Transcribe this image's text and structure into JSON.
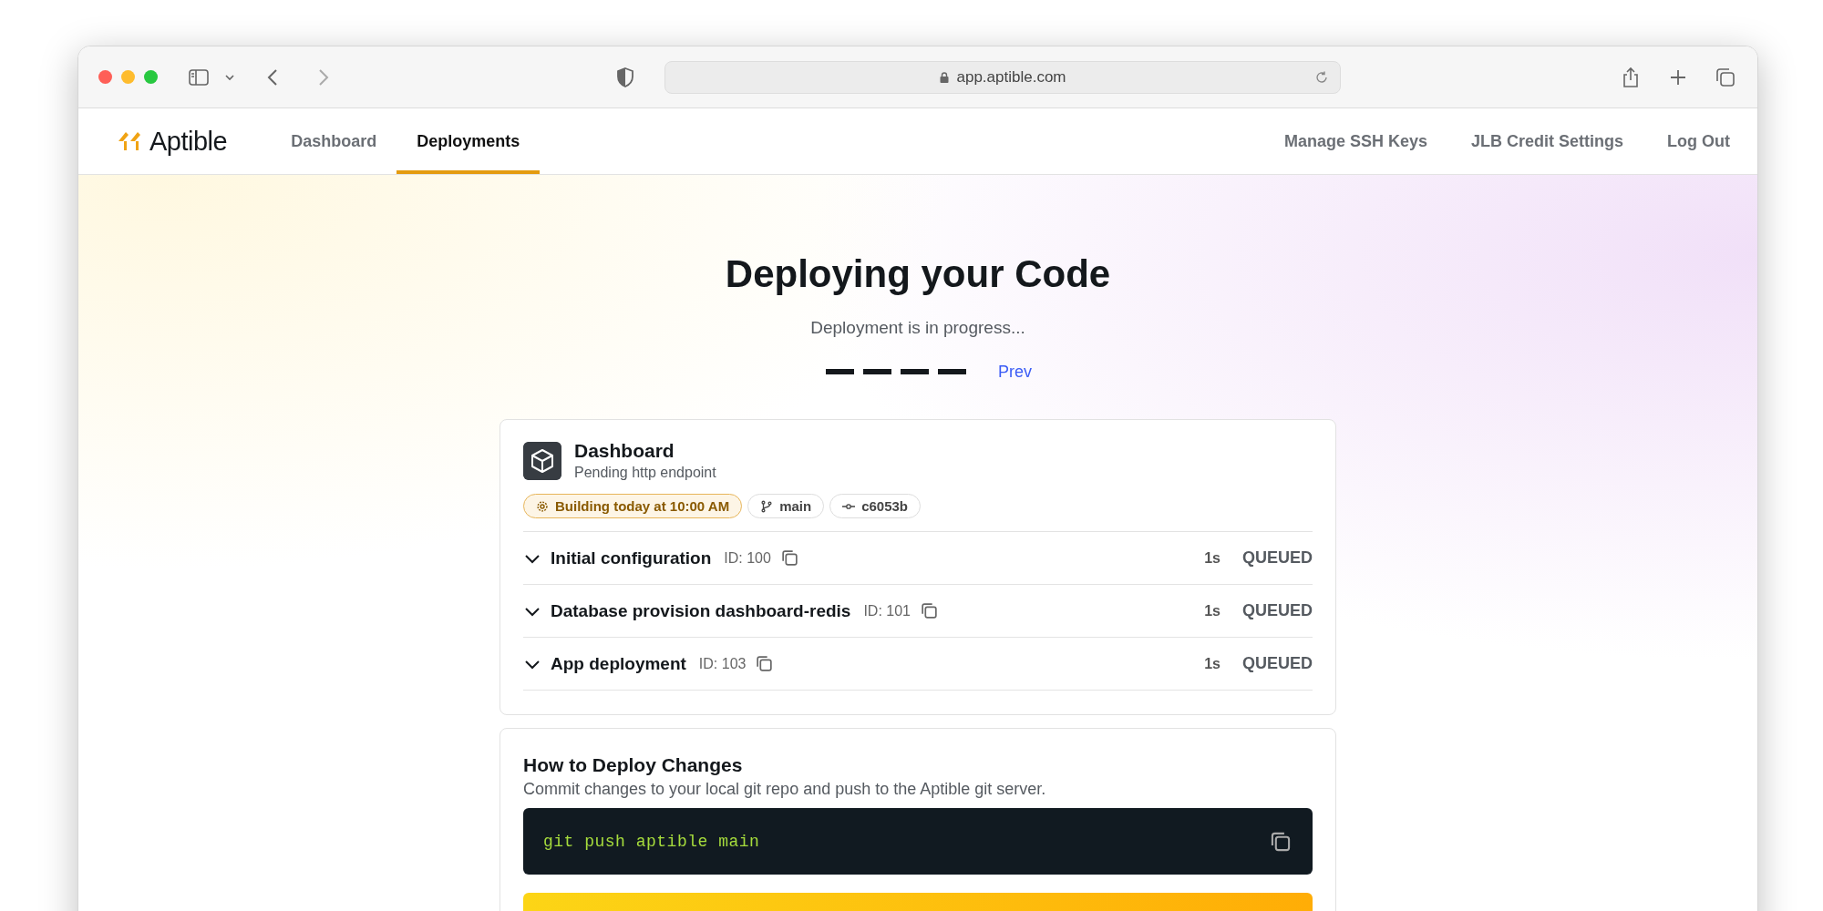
{
  "browser": {
    "url": "app.aptible.com"
  },
  "nav": {
    "logo": "Aptible",
    "tabs": [
      {
        "label": "Dashboard",
        "selected": false
      },
      {
        "label": "Deployments",
        "selected": true
      }
    ],
    "links": [
      "Manage SSH Keys",
      "JLB Credit Settings",
      "Log Out"
    ]
  },
  "page": {
    "title": "Deploying your Code",
    "subtitle": "Deployment is in progress...",
    "prev": "Prev"
  },
  "app_card": {
    "name": "Dashboard",
    "status": "Pending http endpoint",
    "badges": [
      {
        "kind": "building",
        "text": "Building today at 10:00 AM"
      },
      {
        "kind": "branch",
        "text": "main"
      },
      {
        "kind": "commit",
        "text": "c6053b"
      }
    ],
    "operations": [
      {
        "name": "Initial configuration",
        "id": "ID: 100",
        "duration": "1s",
        "status": "QUEUED",
        "expanded": false
      },
      {
        "name": "Database provision dashboard-redis",
        "id": "ID: 101",
        "duration": "1s",
        "status": "QUEUED",
        "expanded": false
      },
      {
        "name": "App deployment",
        "id": "ID: 103",
        "duration": "1s",
        "status": "QUEUED",
        "expanded": false
      }
    ]
  },
  "deploy_card": {
    "title": "How to Deploy Changes",
    "description": "Commit changes to your local git repo and push to the Aptible git server.",
    "command": "git push aptible main"
  }
}
